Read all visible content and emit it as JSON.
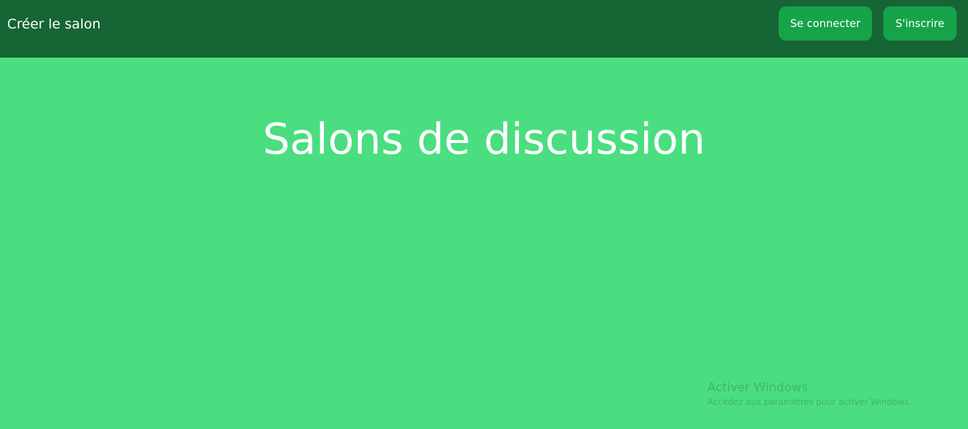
{
  "header": {
    "create_room_label": "Créer le salon",
    "login_label": "Se connecter",
    "signup_label": "S'inscrire"
  },
  "main": {
    "title": "Salons de discussion"
  },
  "watermark": {
    "title": "Activer Windows",
    "subtitle": "Accédez aux paramètres pour activer Windows."
  },
  "colors": {
    "background": "#4ade80",
    "header_background": "#166534",
    "button_background": "#16a34a",
    "text": "#ffffff"
  }
}
